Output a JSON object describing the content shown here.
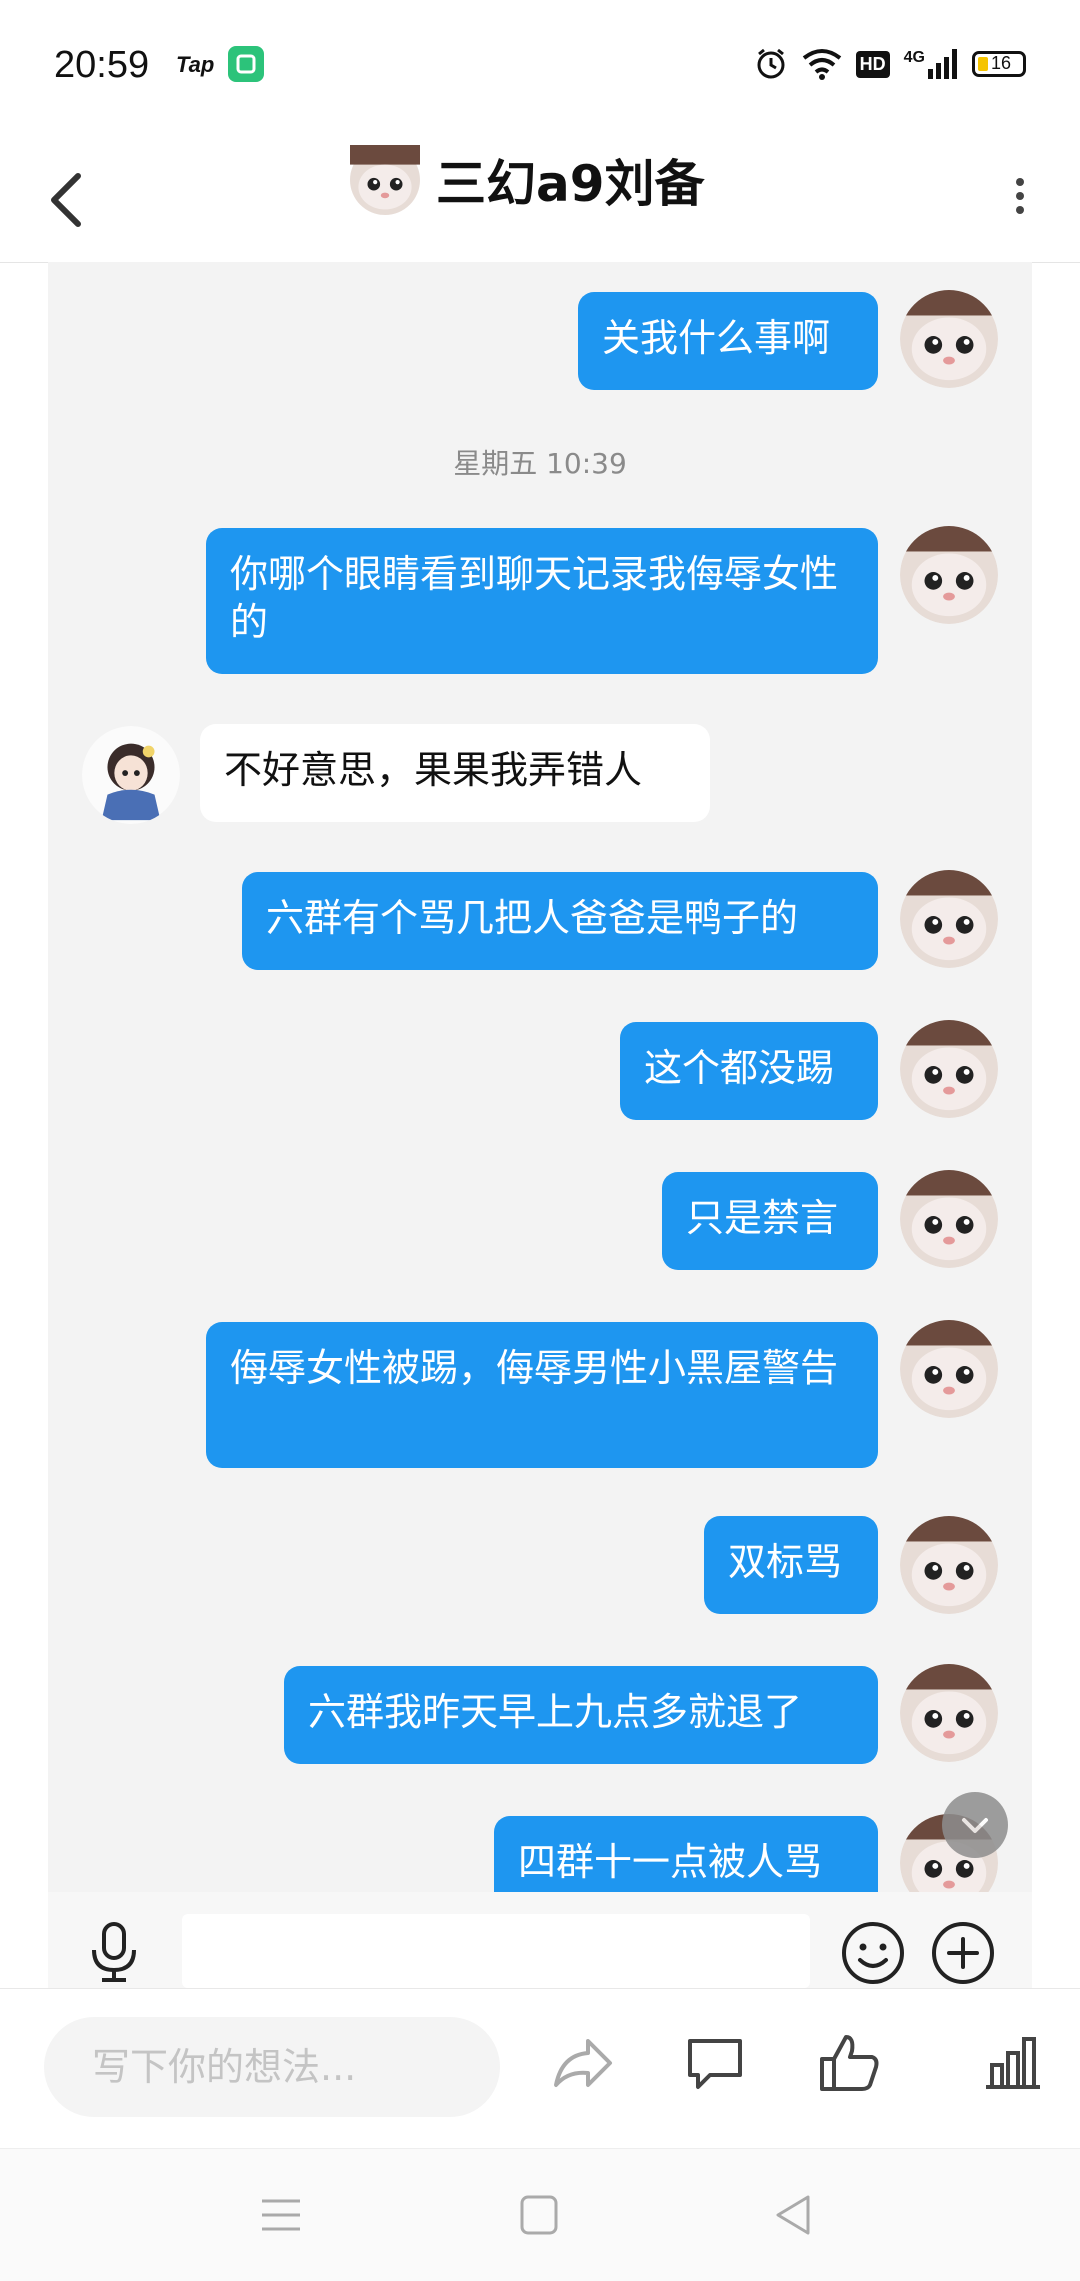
{
  "status_bar": {
    "time": "20:59",
    "app_label": "Tap",
    "icons": [
      "app-notification-icon",
      "alarm-icon",
      "wifi-icon",
      "hd-icon",
      "4g-signal-icon",
      "battery-icon"
    ],
    "hd_label": "HD",
    "network_label": "4G",
    "battery_level": "16"
  },
  "header": {
    "title": "三幻a9刘备",
    "back_icon": "back-arrow-icon",
    "menu_icon": "more-vertical-icon"
  },
  "chat": {
    "timestamp": "星期五 10:39",
    "messages": [
      {
        "from": "me",
        "text": "关我什么事啊"
      },
      {
        "from": "me",
        "text": "你哪个眼睛看到聊天记录我侮辱女性的"
      },
      {
        "from": "other",
        "text": "不好意思，果果我弄错人"
      },
      {
        "from": "me",
        "text": "六群有个骂几把人爸爸是鸭子的"
      },
      {
        "from": "me",
        "text": "这个都没踢"
      },
      {
        "from": "me",
        "text": "只是禁言"
      },
      {
        "from": "me",
        "text": "侮辱女性被踢，侮辱男性小黑屋警告"
      },
      {
        "from": "me",
        "text": "双标骂"
      },
      {
        "from": "me",
        "text": "六群我昨天早上九点多就退了"
      },
      {
        "from": "me",
        "text": "四群十一点被人骂"
      }
    ]
  },
  "input_bar": {
    "value": "",
    "icons": [
      "microphone-icon",
      "emoji-icon",
      "plus-icon"
    ]
  },
  "action_bar": {
    "placeholder": "写下你的想法...",
    "icons": [
      "share-icon",
      "comment-icon",
      "like-icon",
      "stats-icon"
    ]
  },
  "nav_bar": {
    "icons": [
      "menu-nav-icon",
      "home-nav-icon",
      "back-nav-icon"
    ]
  },
  "colors": {
    "bubble_out": "#1e96f0",
    "bubble_in": "#ffffff",
    "chat_bg": "#f3f3f3"
  }
}
